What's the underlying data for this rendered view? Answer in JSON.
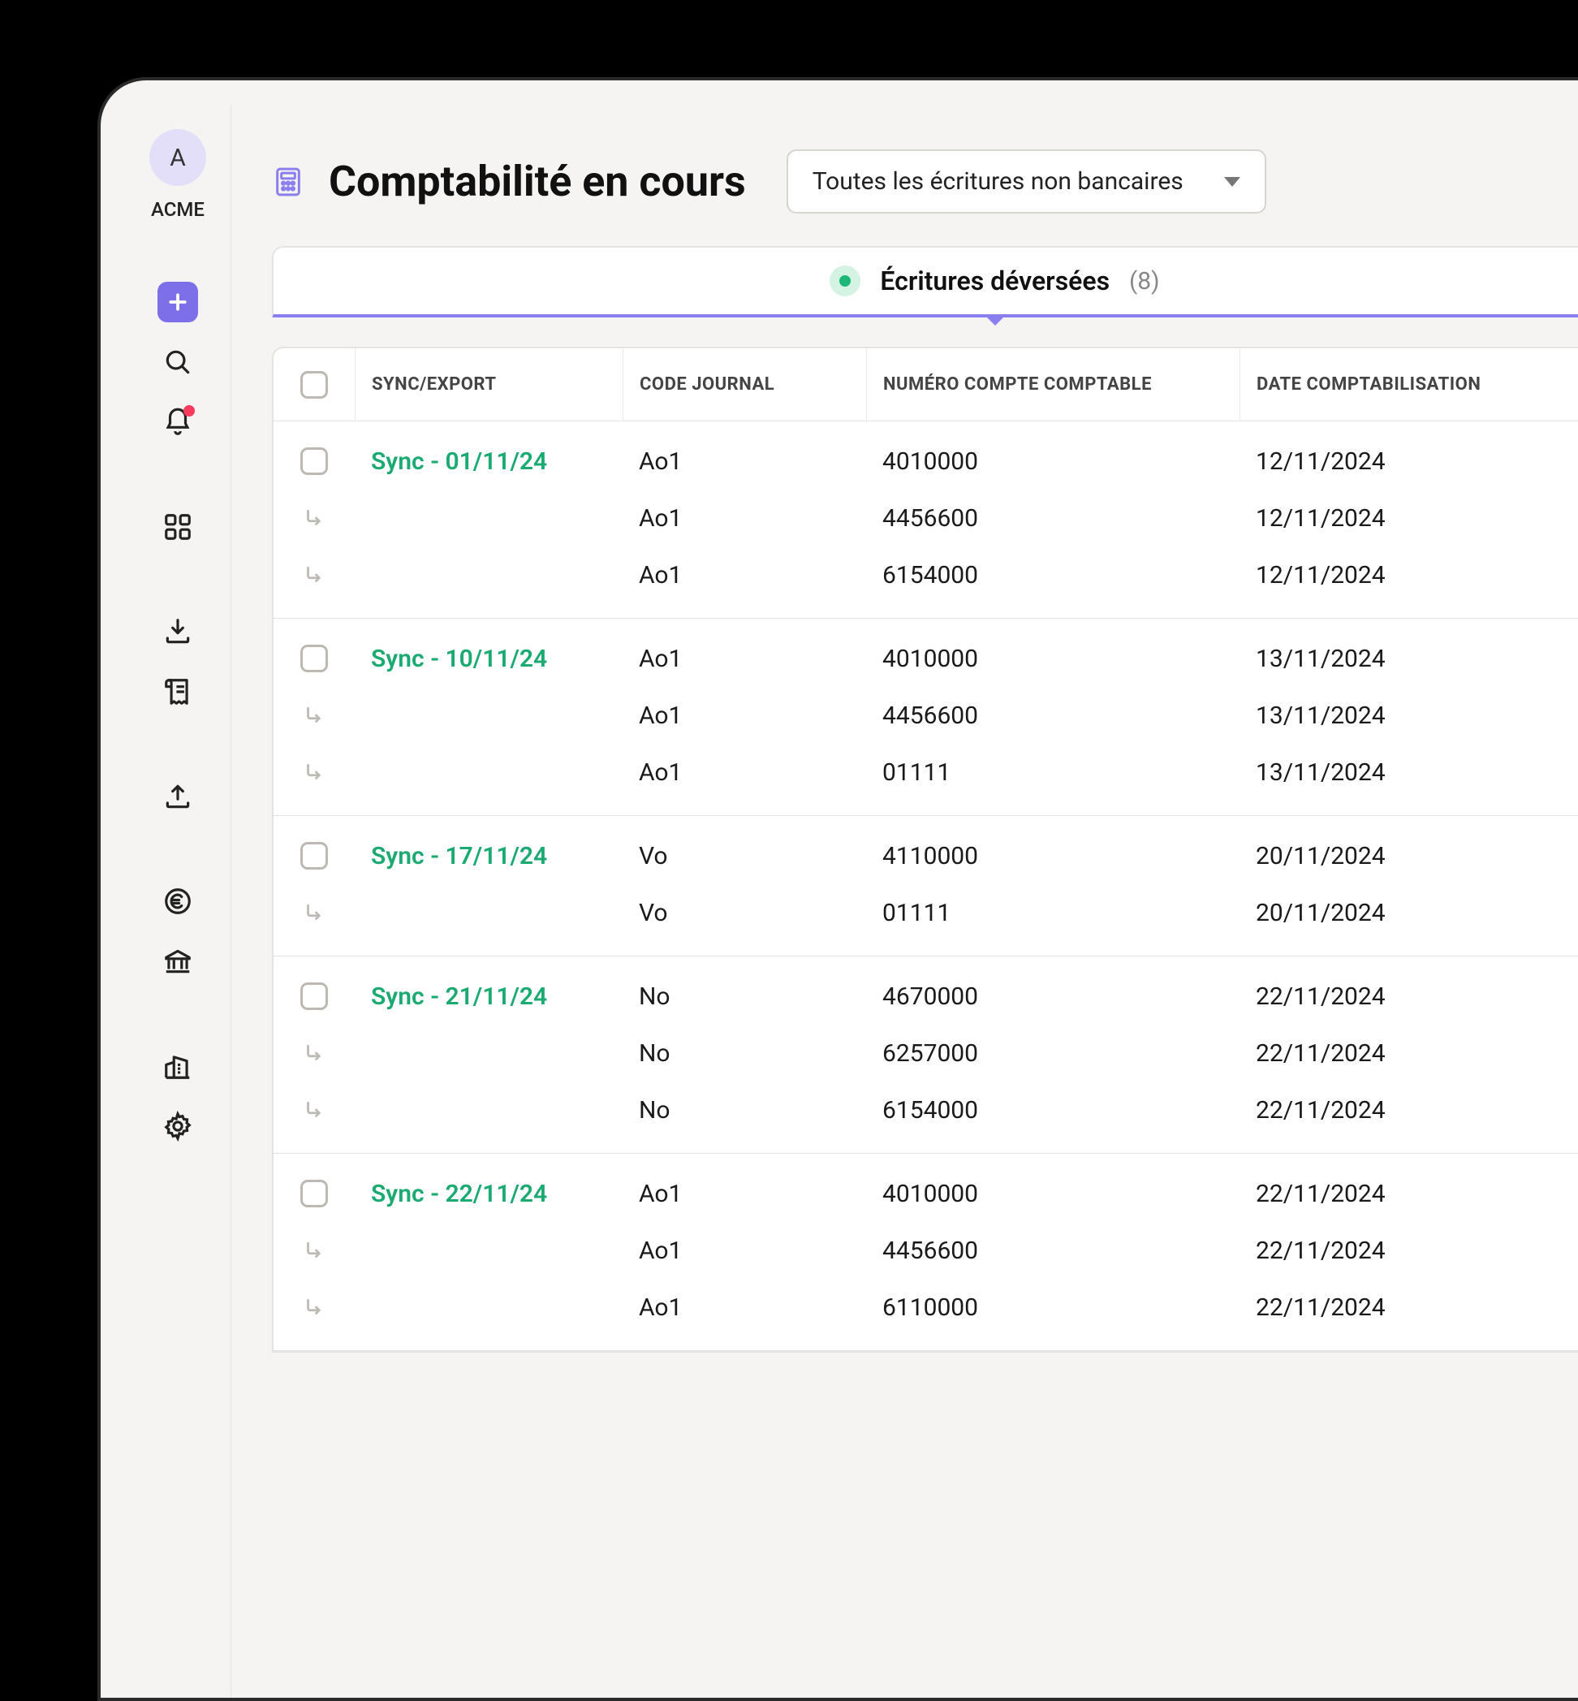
{
  "sidebar": {
    "avatar_letter": "A",
    "org_name": "ACME"
  },
  "header": {
    "title": "Comptabilité en cours",
    "filter_label": "Toutes les écritures non bancaires"
  },
  "tabs": {
    "active_label": "Écritures déversées",
    "active_count": "(8)"
  },
  "table": {
    "columns": {
      "sync": "SYNC/EXPORT",
      "journal": "CODE JOURNAL",
      "account": "NUMÉRO COMPTE COMPTABLE",
      "date": "DATE COMPTABILISATION"
    },
    "groups": [
      {
        "sync": "Sync - 01/11/24",
        "rows": [
          {
            "journal": "Ao1",
            "account": "4010000",
            "date": "12/11/2024"
          },
          {
            "journal": "Ao1",
            "account": "4456600",
            "date": "12/11/2024"
          },
          {
            "journal": "Ao1",
            "account": "6154000",
            "date": "12/11/2024"
          }
        ]
      },
      {
        "sync": "Sync - 10/11/24",
        "rows": [
          {
            "journal": "Ao1",
            "account": "4010000",
            "date": "13/11/2024"
          },
          {
            "journal": "Ao1",
            "account": "4456600",
            "date": "13/11/2024"
          },
          {
            "journal": "Ao1",
            "account": "01111",
            "date": "13/11/2024"
          }
        ]
      },
      {
        "sync": "Sync - 17/11/24",
        "rows": [
          {
            "journal": "Vo",
            "account": "4110000",
            "date": "20/11/2024"
          },
          {
            "journal": "Vo",
            "account": "01111",
            "date": "20/11/2024"
          }
        ]
      },
      {
        "sync": "Sync - 21/11/24",
        "rows": [
          {
            "journal": "No",
            "account": "4670000",
            "date": "22/11/2024"
          },
          {
            "journal": "No",
            "account": "6257000",
            "date": "22/11/2024"
          },
          {
            "journal": "No",
            "account": "6154000",
            "date": "22/11/2024"
          }
        ]
      },
      {
        "sync": "Sync - 22/11/24",
        "rows": [
          {
            "journal": "Ao1",
            "account": "4010000",
            "date": "22/11/2024"
          },
          {
            "journal": "Ao1",
            "account": "4456600",
            "date": "22/11/2024"
          },
          {
            "journal": "Ao1",
            "account": "6110000",
            "date": "22/11/2024"
          }
        ]
      }
    ]
  }
}
